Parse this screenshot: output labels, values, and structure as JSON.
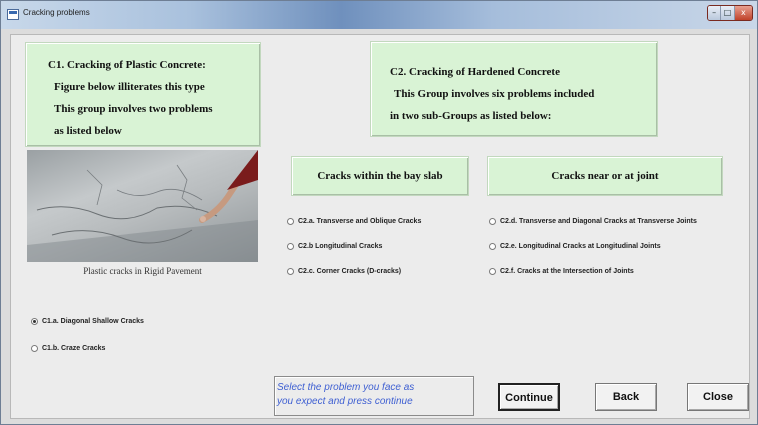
{
  "window": {
    "title": "Cracking problems",
    "controls": {
      "minimize": "–",
      "maximize": "□",
      "close": "x"
    }
  },
  "c1": {
    "lines": [
      "C1. Cracking of Plastic Concrete:",
      "Figure below illiterates this type",
      "This group involves two problems",
      "as listed below"
    ],
    "photo_caption": "Plastic cracks in Rigid Pavement",
    "options": [
      {
        "label": "C1.a. Diagonal Shallow Cracks",
        "selected": true
      },
      {
        "label": "C1.b. Craze Cracks",
        "selected": false
      }
    ]
  },
  "c2": {
    "lines": [
      "C2. Cracking of Hardened Concrete",
      "This Group involves six problems included",
      "in two sub-Groups as listed below:"
    ],
    "bay_slab": {
      "heading": "Cracks within the bay slab",
      "options": [
        {
          "label": "C2.a. Transverse and Oblique Cracks",
          "selected": false
        },
        {
          "label": "C2.b Longitudinal Cracks",
          "selected": false
        },
        {
          "label": "C2.c. Corner Cracks (D-cracks)",
          "selected": false
        }
      ]
    },
    "joint": {
      "heading": "Cracks near or at joint",
      "options": [
        {
          "label": "C2.d. Transverse and Diagonal Cracks at Transverse Joints",
          "selected": false
        },
        {
          "label": "C2.e. Longitudinal Cracks at Longitudinal Joints",
          "selected": false
        },
        {
          "label": "C2.f. Cracks at the Intersection of Joints",
          "selected": false
        }
      ]
    }
  },
  "status": {
    "lines": [
      "Select the problem you face as",
      "you expect and press continue"
    ],
    "color": "#3e5fd2"
  },
  "buttons": {
    "continue": "Continue",
    "back": "Back",
    "close": "Close"
  },
  "colors": {
    "panel_green": "#d9f3d5",
    "window_bg": "#dcdcdc"
  }
}
